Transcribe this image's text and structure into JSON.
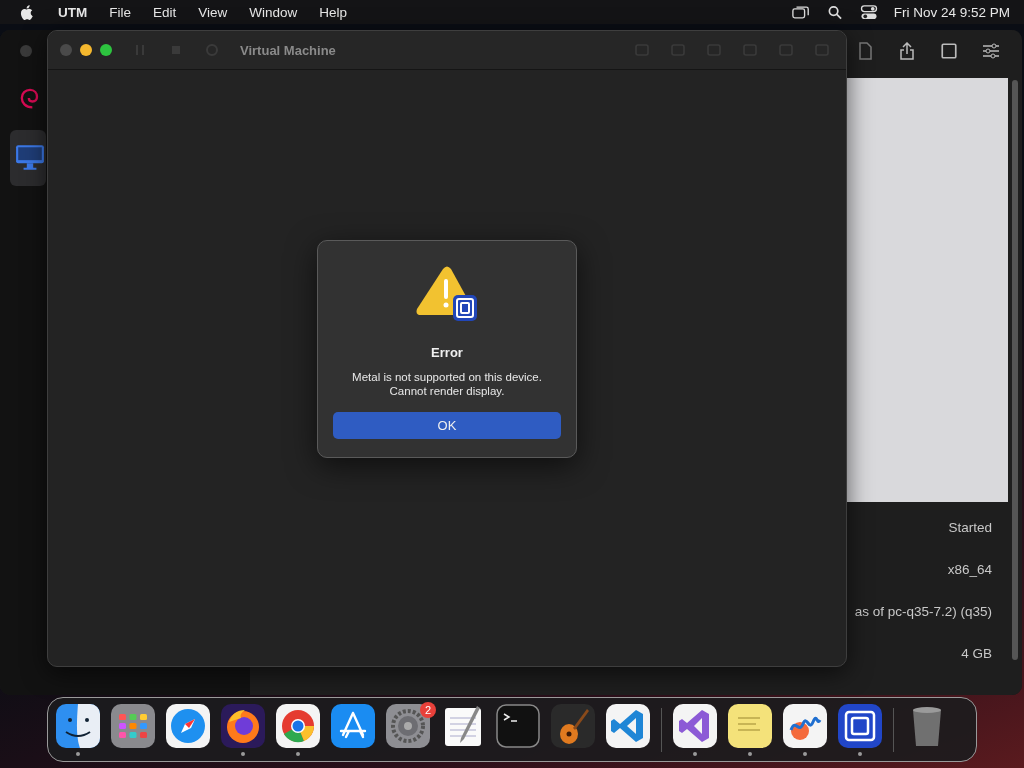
{
  "menu_bar": {
    "menus": [
      {
        "label": "UTM",
        "kind": "app"
      },
      {
        "label": "File",
        "kind": "menu"
      },
      {
        "label": "Edit",
        "kind": "menu"
      },
      {
        "label": "View",
        "kind": "menu"
      },
      {
        "label": "Window",
        "kind": "menu"
      },
      {
        "label": "Help",
        "kind": "menu"
      }
    ],
    "clock": "Fri Nov 24  9:52 PM"
  },
  "main_window": {
    "sidebar": {
      "items": [
        {
          "kind": "debian",
          "selected": false
        },
        {
          "kind": "vm",
          "selected": true
        }
      ]
    },
    "details": [
      {
        "value": "Started"
      },
      {
        "value": "x86_64"
      },
      {
        "value": "as of pc-q35-7.2) (q35)"
      },
      {
        "value": "4 GB"
      }
    ]
  },
  "vm_window": {
    "title": "Virtual Machine"
  },
  "alert": {
    "title": "Error",
    "message": "Metal is not supported on this device.\nCannot render display.",
    "button": "OK"
  },
  "dock": {
    "apps": [
      {
        "kind": "finder",
        "running": true
      },
      {
        "kind": "launchpad",
        "running": false
      },
      {
        "kind": "safari",
        "running": false
      },
      {
        "kind": "firefox",
        "running": true
      },
      {
        "kind": "chrome",
        "running": true
      },
      {
        "kind": "appstore",
        "running": false
      },
      {
        "kind": "settings",
        "running": false,
        "badge": "2"
      },
      {
        "kind": "textedit",
        "running": false
      },
      {
        "kind": "terminal",
        "running": false
      },
      {
        "kind": "garageband",
        "running": false
      },
      {
        "kind": "vscode",
        "running": false
      },
      {
        "kind": "separator"
      },
      {
        "kind": "visualstudio",
        "running": true
      },
      {
        "kind": "stickies",
        "running": true
      },
      {
        "kind": "freeform",
        "running": true
      },
      {
        "kind": "utm",
        "running": true
      },
      {
        "kind": "separator"
      },
      {
        "kind": "trash",
        "running": false
      }
    ]
  }
}
